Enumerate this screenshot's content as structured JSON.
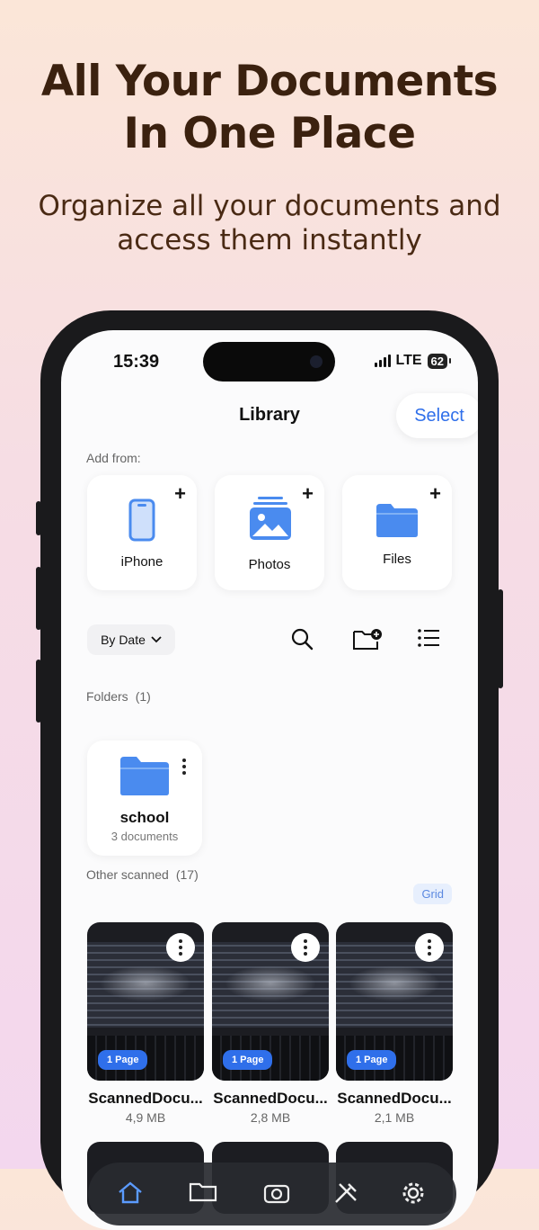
{
  "hero": {
    "title_line1": "All Your Documents",
    "title_line2": "In One Place",
    "subtitle_line1": "Organize all your documents and",
    "subtitle_line2": "access them instantly"
  },
  "status_bar": {
    "time": "15:39",
    "network": "LTE",
    "battery": "62"
  },
  "header": {
    "title": "Library",
    "select_label": "Select"
  },
  "add_from": {
    "label": "Add from:",
    "sources": [
      {
        "label": "iPhone",
        "icon": "iphone-icon"
      },
      {
        "label": "Photos",
        "icon": "photos-icon"
      },
      {
        "label": "Files",
        "icon": "folder-icon"
      }
    ]
  },
  "toolbar": {
    "sort_label": "By Date"
  },
  "folders": {
    "label": "Folders",
    "count": "(1)",
    "items": [
      {
        "name": "school",
        "subtitle": "3 documents"
      }
    ]
  },
  "scanned": {
    "label": "Other scanned",
    "count": "(17)",
    "view_mode": "Grid",
    "items": [
      {
        "name": "ScannedDocu...",
        "size": "4,9 MB",
        "pages": "1 Page"
      },
      {
        "name": "ScannedDocu...",
        "size": "2,8 MB",
        "pages": "1 Page"
      },
      {
        "name": "ScannedDocu...",
        "size": "2,1 MB",
        "pages": "1 Page"
      }
    ]
  },
  "colors": {
    "accent": "#2f6fea",
    "folder": "#4a8bef",
    "hero_text": "#3b210f"
  }
}
